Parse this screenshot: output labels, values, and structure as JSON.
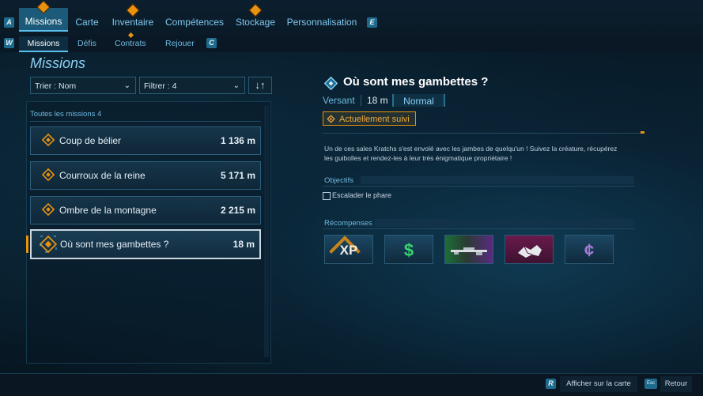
{
  "nav": {
    "key_left": "A",
    "key_right": "E",
    "tabs": [
      {
        "label": "Missions",
        "warning": true
      },
      {
        "label": "Carte",
        "warning": false
      },
      {
        "label": "Inventaire",
        "warning": true
      },
      {
        "label": "Compétences",
        "warning": false
      },
      {
        "label": "Stockage",
        "warning": true
      },
      {
        "label": "Personnalisation",
        "warning": false
      }
    ]
  },
  "subnav": {
    "key_left": "W",
    "key_right": "C",
    "tabs": [
      "Missions",
      "Défis",
      "Contrats",
      "Rejouer"
    ]
  },
  "panel_title": "Missions",
  "sort": {
    "label": "Trier : Nom"
  },
  "filter": {
    "label": "Filtrer : 4"
  },
  "list": {
    "header": "Toutes les missions 4",
    "items": [
      {
        "name": "Coup de bélier",
        "distance": "1 136 m"
      },
      {
        "name": "Courroux de la reine",
        "distance": "5 171 m"
      },
      {
        "name": "Ombre de la montagne",
        "distance": "2 215 m"
      },
      {
        "name": "Où sont mes gambettes ?",
        "distance": "18 m"
      }
    ]
  },
  "detail": {
    "title": "Où sont mes gambettes ?",
    "location": "Versant",
    "distance": "18 m",
    "difficulty": "Normal",
    "status": "Actuellement suivi",
    "description": "Un de ces sales Kratchs s'est envolé avec les jambes de quelqu'un ! Suivez la créature, récupérez les guibolles et rendez-les à leur très énigmatique propriétaire !",
    "objectives_header": "Objectifs",
    "objective": "Escalader le phare",
    "rewards_header": "Récompenses",
    "rewards": [
      {
        "icon": "xp-icon",
        "label": "XP"
      },
      {
        "icon": "cash-icon",
        "label": "$"
      },
      {
        "icon": "sniper-rifle-icon",
        "label": ""
      },
      {
        "icon": "cosmetic-icon",
        "label": ""
      },
      {
        "icon": "eridium-icon",
        "label": "¢"
      }
    ]
  },
  "bottom": {
    "map_key": "R",
    "map_label": "Afficher sur la carte",
    "back_key": "Esc",
    "back_label": "Retour"
  },
  "colors": {
    "accent": "#5bc0ef",
    "tracked": "#e8920f",
    "warning": "#e8920f"
  }
}
